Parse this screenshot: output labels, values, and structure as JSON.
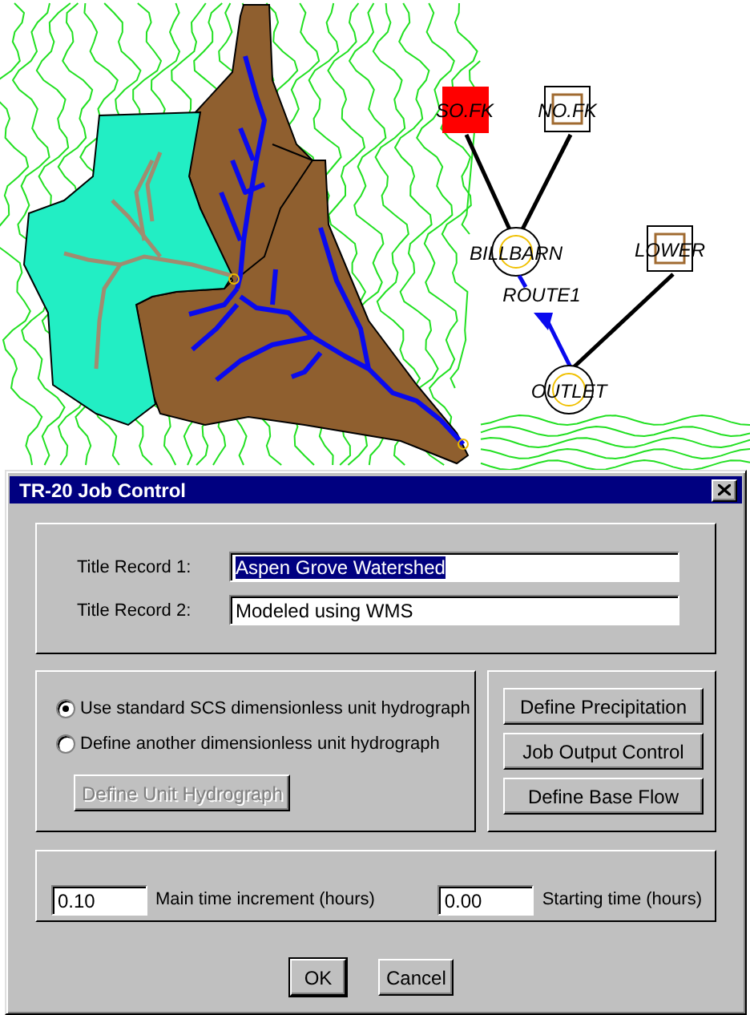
{
  "map": {
    "nodes": [
      {
        "label": "SO.FK",
        "kind": "basin",
        "selected": true
      },
      {
        "label": "NO.FK",
        "kind": "basin",
        "selected": false
      },
      {
        "label": "BILLBARN",
        "kind": "outlet",
        "selected": false
      },
      {
        "label": "LOWER",
        "kind": "basin",
        "selected": false
      },
      {
        "label": "ROUTE1",
        "kind": "reach",
        "selected": false
      },
      {
        "label": "OUTLET",
        "kind": "outlet",
        "selected": false
      }
    ]
  },
  "dialog": {
    "title": "TR-20 Job Control",
    "title_records": [
      {
        "label": "Title Record 1:",
        "value": "Aspen Grove Watershed",
        "selected": true
      },
      {
        "label": "Title Record 2:",
        "value": "Modeled using WMS",
        "selected": false
      }
    ],
    "hydrograph_options": [
      {
        "label": "Use standard SCS dimensionless unit hydrograph",
        "selected": true
      },
      {
        "label": "Define another dimensionless unit hydrograph",
        "selected": false
      }
    ],
    "unit_hydrograph_button": {
      "label": "Define Unit Hydrograph",
      "disabled": true
    },
    "side_buttons": [
      "Define Precipitation",
      "Job Output Control",
      "Define Base Flow"
    ],
    "times": [
      {
        "input": "0.10",
        "caption_after": "Main time increment (hours)"
      },
      {
        "input": "0.00",
        "caption_after": "Starting time (hours)"
      }
    ],
    "buttons": [
      {
        "label": "OK",
        "default": true
      },
      {
        "label": "Cancel",
        "default": false
      }
    ]
  }
}
